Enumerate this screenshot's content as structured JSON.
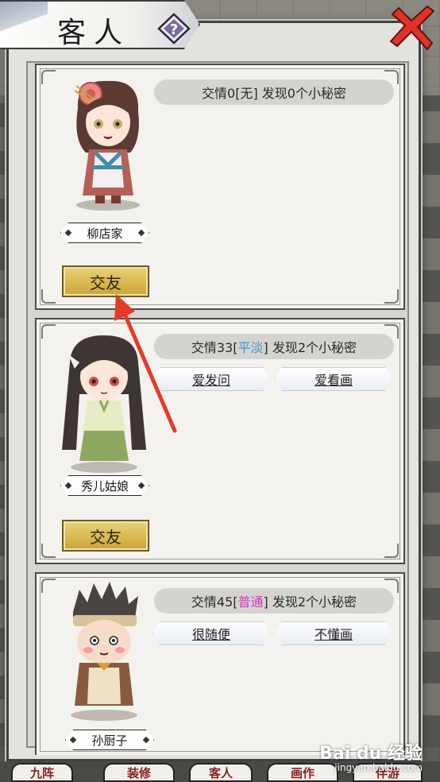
{
  "window": {
    "title": "客人"
  },
  "bottom_tabs": [
    "九阵",
    "装修",
    "客人",
    "画作",
    "伴游"
  ],
  "guests": [
    {
      "name": "柳店家",
      "info_prefix": "交情0[",
      "relation": "无",
      "info_suffix": "] 发现0个小秘密",
      "secrets": [],
      "button": "交友"
    },
    {
      "name": "秀儿姑娘",
      "info_prefix": "交情33[",
      "relation": "平淡",
      "info_suffix": "] 发现2个小秘密",
      "secrets": [
        "爱发问",
        "爱看画"
      ],
      "button": "交友"
    },
    {
      "name": "孙厨子",
      "info_prefix": "交情45[",
      "relation": "普通",
      "info_suffix": "] 发现2个小秘密",
      "secrets": [
        "很随便",
        "不懂画"
      ],
      "button": ""
    }
  ],
  "colors": {
    "relation_flat": "#3a9ad6",
    "relation_normal": "#d630c8",
    "button_gold": "#d8b64d",
    "annotation_red": "#e53a2a"
  },
  "icons": [
    "help-icon",
    "close-icon"
  ],
  "watermark": {
    "logo": "Bai du 经验",
    "sub": "jingyan.baidu.com"
  }
}
